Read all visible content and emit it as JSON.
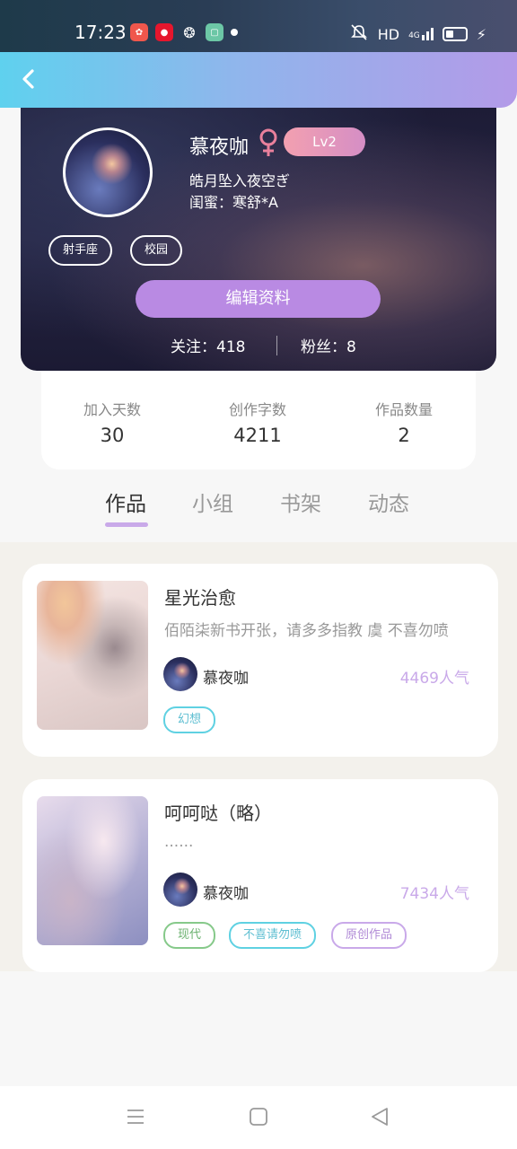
{
  "status_bar": {
    "time": "17:23",
    "network": "HD",
    "signal": "4G",
    "notification_icons": [
      "xiaohongshu-icon",
      "weibo-icon",
      "wechat-icon",
      "app-icon",
      "dot-icon"
    ]
  },
  "profile": {
    "name": "慕夜咖",
    "gender_symbol": "♀",
    "level": "Lv2",
    "bio": "皓月坠入夜空ぎ",
    "bestie": "闺蜜：寒舒*A",
    "tags": [
      "射手座",
      "校园"
    ],
    "edit_label": "编辑资料",
    "following": "关注：418",
    "followers": "粉丝：8"
  },
  "stats": [
    {
      "label": "加入天数",
      "value": "30"
    },
    {
      "label": "创作字数",
      "value": "4211"
    },
    {
      "label": "作品数量",
      "value": "2"
    }
  ],
  "tabs": [
    "作品",
    "小组",
    "书架",
    "动态"
  ],
  "works": [
    {
      "title": "星光治愈",
      "desc": "佰陌柒新书开张，请多多指教 虞 不喜勿喷",
      "author": "慕夜咖",
      "popularity": "4469人气",
      "tags": [
        "幻想"
      ]
    },
    {
      "title": "呵呵哒（略）",
      "desc": "......",
      "author": "慕夜咖",
      "popularity": "7434人气",
      "tags": [
        "现代",
        "不喜请勿喷",
        "原创作品"
      ]
    }
  ],
  "colors": {
    "accent_purple": "#b98ae3",
    "level_badge": "#e89bbd",
    "nav_gradient_start": "#5fd1ee",
    "nav_gradient_end": "#b39ae8"
  }
}
